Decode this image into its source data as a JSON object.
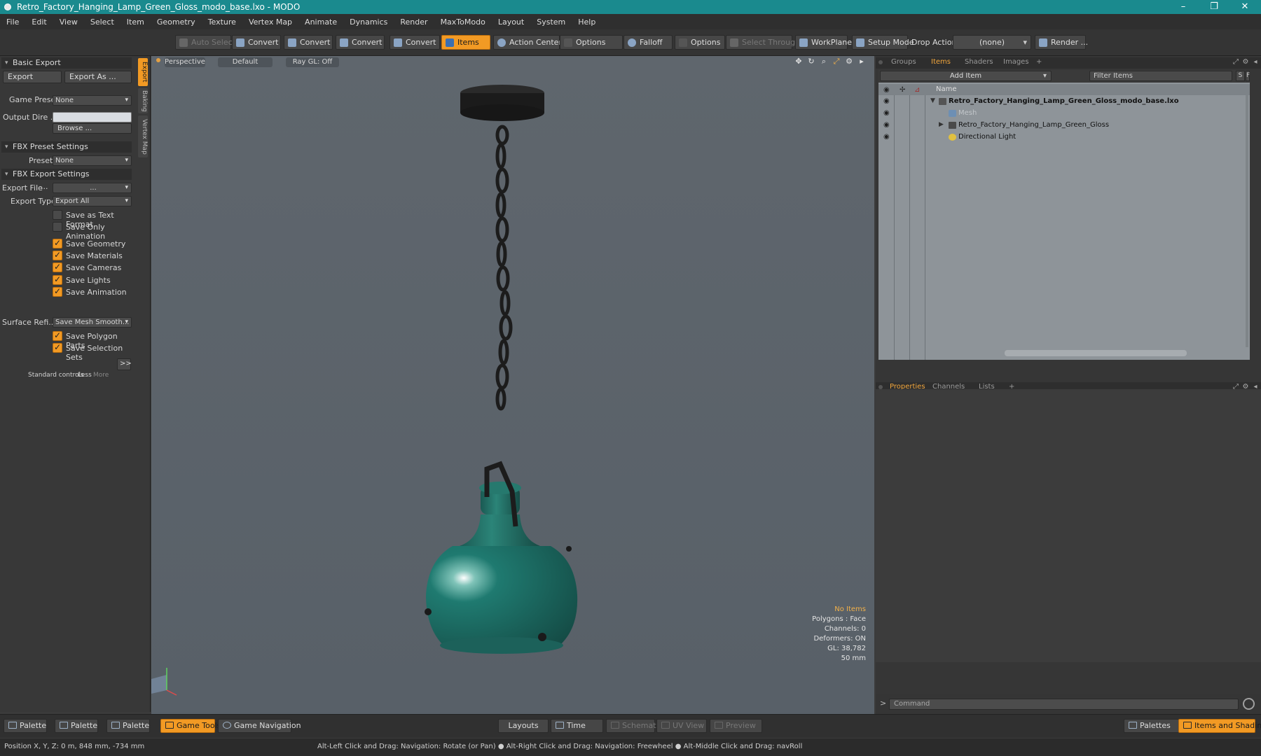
{
  "window": {
    "title": "Retro_Factory_Hanging_Lamp_Green_Gloss_modo_base.lxo - MODO",
    "minimize": "–",
    "maximize": "❐",
    "close": "✕"
  },
  "menu": [
    "File",
    "Edit",
    "View",
    "Select",
    "Item",
    "Geometry",
    "Texture",
    "Vertex Map",
    "Animate",
    "Dynamics",
    "Render",
    "MaxToModo",
    "Layout",
    "System",
    "Help"
  ],
  "toolbar": {
    "auto_select": "Auto Select",
    "convert": "Convert",
    "items": "Items",
    "action_center": "Action Center",
    "options": "Options",
    "falloff": "Falloff",
    "select_through": "Select Through",
    "workplane": "WorkPlane",
    "setup_mode": "Setup Mode",
    "drop_action_label": "Drop Action",
    "drop_action_value": "(none)",
    "render": "Render ..."
  },
  "left_panel": {
    "vertical_tabs": [
      "Export",
      "Baking",
      "Vertex Map"
    ],
    "basic_export": "Basic Export",
    "export_btn": "Export",
    "export_as_btn": "Export As ...",
    "game_preset_label": "Game Preset",
    "game_preset_value": "None",
    "output_dir_label": "Output Dire ...",
    "output_dir_value": "",
    "browse": "Browse ...",
    "fbx_preset_settings": "FBX Preset Settings",
    "preset_label": "Preset",
    "preset_value": "None",
    "fbx_export_settings": "FBX Export Settings",
    "export_file_label": "Export File",
    "export_file_value": "...",
    "export_type_label": "Export Type",
    "export_type_value": "Export All",
    "checkboxes": [
      {
        "label": "Save as Text Format",
        "checked": false
      },
      {
        "label": "Save Only Animation",
        "checked": false
      },
      {
        "label": "Save Geometry",
        "checked": true
      },
      {
        "label": "Save Materials",
        "checked": true
      },
      {
        "label": "Save Cameras",
        "checked": true
      },
      {
        "label": "Save Lights",
        "checked": true
      },
      {
        "label": "Save Animation",
        "checked": true
      }
    ],
    "surface_refi_label": "Surface Refi...",
    "surface_refi_value": "Save Mesh Smooth...",
    "checkboxes2": [
      {
        "label": "Save Polygon Parts",
        "checked": true
      },
      {
        "label": "Save Selection Sets",
        "checked": true
      }
    ],
    "more_btn": ">>",
    "standard_controls": "Standard controls",
    "less": "Less",
    "more": "More"
  },
  "viewport": {
    "view_mode": "Perspective",
    "shading": "Default",
    "raygl": "Ray GL: Off",
    "info": {
      "selection": "No Items",
      "polygons": "Polygons : Face",
      "channels": "Channels: 0",
      "deformers": "Deformers: ON",
      "gl": "GL: 38,782",
      "focal": "50 mm"
    },
    "colors": {
      "lamp_green": "#1e6a62",
      "chain": "#1c1c1c"
    }
  },
  "right_panel": {
    "top_tabs": [
      "Groups",
      "Items",
      "Shaders",
      "Images",
      "+"
    ],
    "add_item": "Add Item",
    "filter_placeholder": "Filter Items",
    "s_btn": "S",
    "f_btn": "F",
    "col_name": "Name",
    "tree": [
      {
        "label": "Retro_Factory_Hanging_Lamp_Green_Gloss_modo_base.lxo",
        "bold": true
      },
      {
        "label": "Mesh",
        "dim": true
      },
      {
        "label": "Retro_Factory_Hanging_Lamp_Green_Gloss"
      },
      {
        "label": "Directional Light"
      }
    ],
    "bottom_tabs": [
      "Properties",
      "Channels",
      "Lists",
      "+"
    ],
    "command_placeholder": "Command",
    "command_prompt": ">"
  },
  "bottom_bar": {
    "palette": "Palette",
    "game_tools": "Game Tools",
    "game_navigation": "Game Navigation",
    "layouts": "Layouts",
    "time": "Time",
    "schematic": "Schematic",
    "uv_view": "UV View",
    "preview": "Preview",
    "palettes": "Palettes",
    "items_and_shading": "Items and Shading"
  },
  "status": {
    "position": "Position X, Y, Z:   0 m, 848 mm, -734 mm",
    "hint": "Alt-Left Click and Drag: Navigation: Rotate (or Pan) ●  Alt-Right Click and Drag: Navigation: Freewheel ●  Alt-Middle Click and Drag: navRoll"
  }
}
